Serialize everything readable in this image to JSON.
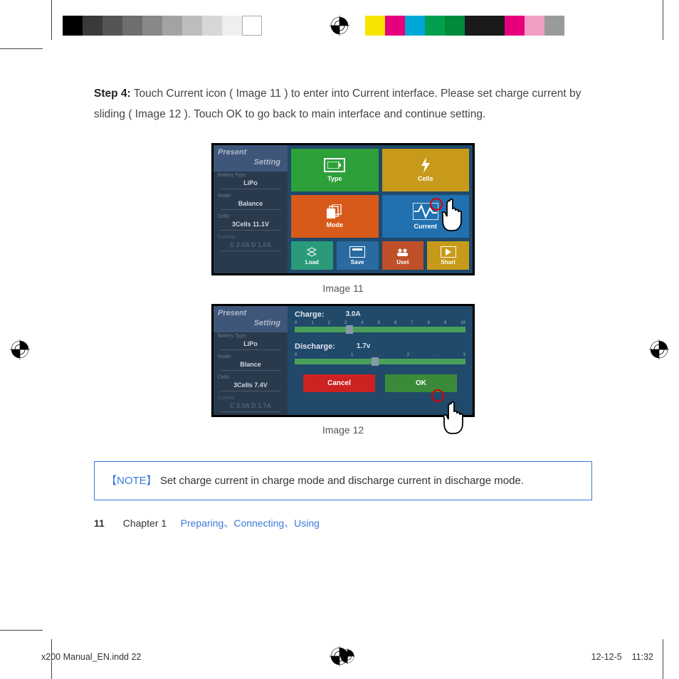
{
  "step": {
    "prefix": "Step 4:",
    "body": " Touch Current icon ( Image 11 ) to enter into Current interface. Please set charge current by sliding ( Image 12 ). Touch OK to go back to main interface and continue setting."
  },
  "img11": {
    "caption": "Image 11",
    "sidebar": {
      "title1": "Present",
      "title2": "Setting",
      "bt_label": "Battery Type:",
      "bt_val": "LiPo",
      "mode_label": "Mode:",
      "mode_val": "Balance",
      "cells_label": "Cells:",
      "cells_val": "3Cells  11.1V",
      "cur_label": "Current:",
      "cur_val": "C 2.0A  D 1.0A"
    },
    "tiles": {
      "type": "Type",
      "cells": "Cells",
      "mode": "Mode",
      "current": "Current",
      "load": "Load",
      "save": "Save",
      "uset": "Uset",
      "shart": "Shart"
    }
  },
  "img12": {
    "caption": "Image 12",
    "sidebar": {
      "title1": "Present",
      "title2": "Setting",
      "bt_label": "Battery Type:",
      "bt_val": "LiPo",
      "mode_label": "Mode:",
      "mode_val": "Blance",
      "cells_label": "Cells:",
      "cells_val": "3Cells  7.4V",
      "cur_label": "Current",
      "cur_val": "C 3.5A  D 1.7A"
    },
    "charge": {
      "label": "Charge:",
      "value": "3.0A",
      "ticks": [
        "0",
        "1",
        "2",
        "3",
        "4",
        "5",
        "6",
        "7",
        "8",
        "9",
        "10"
      ]
    },
    "discharge": {
      "label": "Discharge:",
      "value": "1.7v",
      "ticks": [
        "0",
        ".",
        "1",
        ".",
        "2",
        ".",
        "3"
      ]
    },
    "cancel": "Cancel",
    "ok": "OK"
  },
  "note": {
    "tag": "【NOTE】",
    "body": " Set charge current in charge mode and  discharge current in discharge mode."
  },
  "chapter": {
    "page": "11",
    "prefix": "Chapter 1",
    "links": "Preparing、Connecting、Using"
  },
  "footer": {
    "file": "x200 Manual_EN.indd   22",
    "date": "12-12-5",
    "time": "11:32"
  },
  "colors": {
    "bar1": [
      "#000",
      "#3a3a3a",
      "#555",
      "#777",
      "#999",
      "#bbb",
      "#ddd",
      "#fff"
    ],
    "bar2": [
      "#f7e400",
      "#e6007e",
      "#00a0d8",
      "#00a050",
      "#009640",
      "#1a1a1a",
      "#e6007e",
      "#f29fc5",
      "#a0a0a0"
    ]
  }
}
